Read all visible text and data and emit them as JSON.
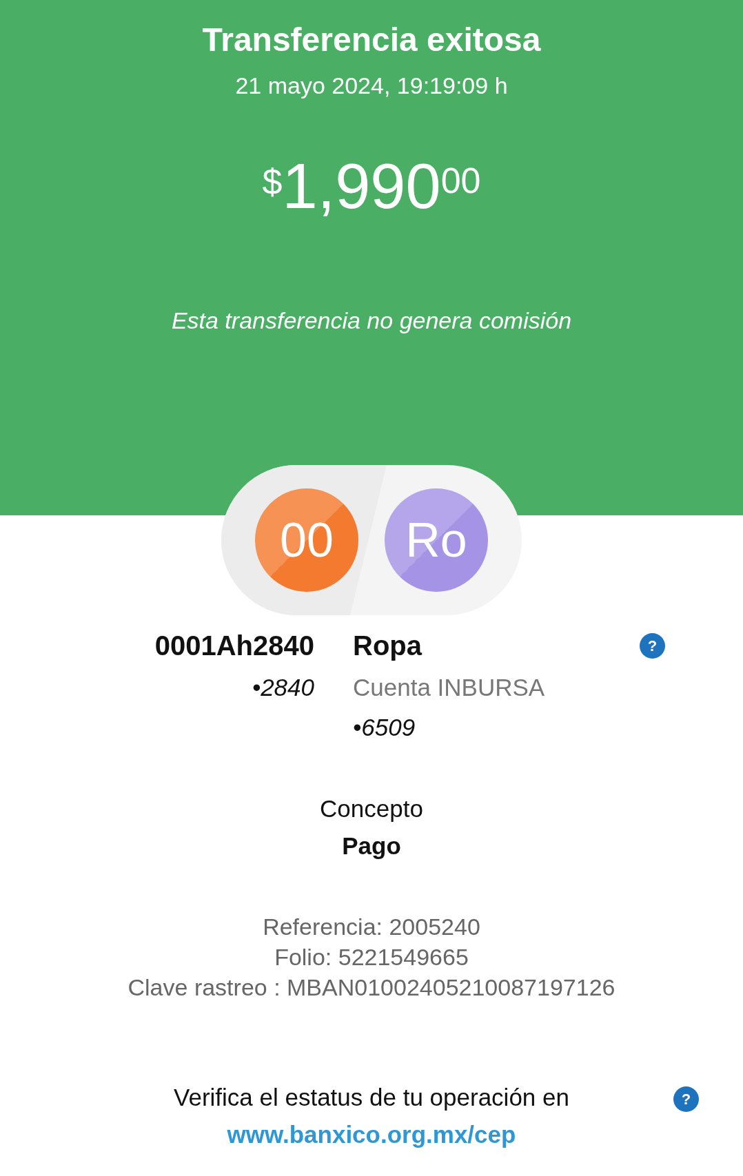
{
  "header": {
    "title": "Transferencia exitosa",
    "datetime": "21 mayo 2024, 19:19:09 h",
    "amount": {
      "currency": "$",
      "whole": "1,990",
      "cents": "00"
    },
    "note": "Esta transferencia no genera comisión"
  },
  "parties": [
    {
      "initials": "00",
      "color": "#f37a2e",
      "name": "0001Ah2840",
      "last4": "•2840"
    },
    {
      "initials": "Ro",
      "color": "#a593e6",
      "name": "Ropa",
      "account": "Cuenta INBURSA",
      "last4": "•6509",
      "help": "?"
    }
  ],
  "concept": {
    "label": "Concepto",
    "value": "Pago"
  },
  "references": [
    "Referencia: 2005240",
    "Folio: 5221549665",
    "Clave rastreo : MBAN01002405210087197126"
  ],
  "verify": {
    "text": "Verifica el estatus de tu operación en",
    "link": "www.banxico.org.mx/cep",
    "help": "?"
  }
}
